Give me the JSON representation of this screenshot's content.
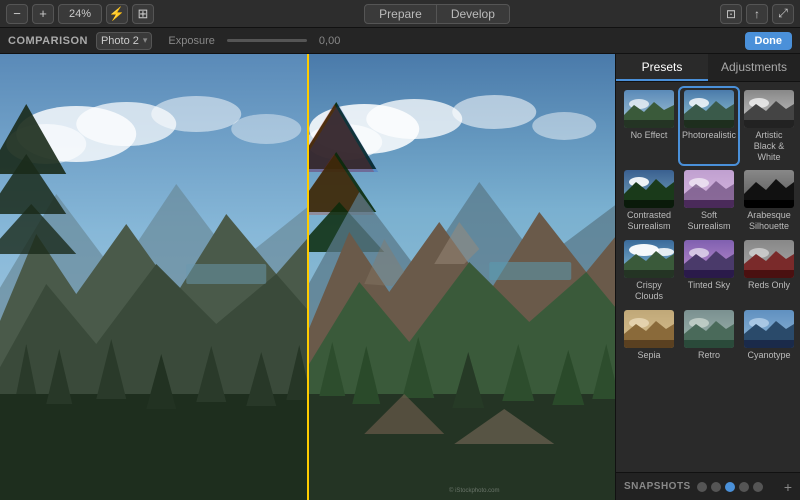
{
  "toolbar": {
    "zoom_out_icon": "−",
    "zoom_in_icon": "+",
    "zoom_level": "24%",
    "lightning_icon": "⚡",
    "layout_icon": "⊞",
    "prepare_label": "Prepare",
    "develop_label": "Develop",
    "window_icon": "⊡",
    "share_icon": "↑",
    "fullscreen_icon": "⤢"
  },
  "secondary_toolbar": {
    "comparison_label": "COMPARISON",
    "photo_label": "Photo 2",
    "exposure_label": "Exposure",
    "exposure_value": "0,00",
    "done_label": "Done"
  },
  "panel": {
    "presets_tab": "Presets",
    "adjustments_tab": "Adjustments",
    "presets": [
      {
        "id": "no-effect",
        "label": "No Effect",
        "style": "original",
        "selected": false
      },
      {
        "id": "photorealistic",
        "label": "Photorealistic",
        "style": "photorealistic",
        "selected": true
      },
      {
        "id": "artistic-bw",
        "label": "Artistic Black & White",
        "style": "bw",
        "selected": false
      },
      {
        "id": "contrasted-surrealism",
        "label": "Contrasted Surrealism",
        "style": "contrasted",
        "selected": false
      },
      {
        "id": "soft-surrealism",
        "label": "Soft Surrealism",
        "style": "soft",
        "selected": false
      },
      {
        "id": "arabesque-silhouette",
        "label": "Arabesque Silhouette",
        "style": "arabesque",
        "selected": false
      },
      {
        "id": "crispy-clouds",
        "label": "Crispy Clouds",
        "style": "crispy",
        "selected": false
      },
      {
        "id": "tinted-sky",
        "label": "Tinted Sky",
        "style": "tinted",
        "selected": false
      },
      {
        "id": "reds-only",
        "label": "Reds Only",
        "style": "reds",
        "selected": false
      },
      {
        "id": "sepia",
        "label": "Sepia",
        "style": "sepia",
        "selected": false
      },
      {
        "id": "retro",
        "label": "Retro",
        "style": "retro",
        "selected": false
      },
      {
        "id": "cyanotype",
        "label": "Cyanotype",
        "style": "cyanotype",
        "selected": false
      }
    ]
  },
  "snapshots": {
    "label": "SNAPSHOTS",
    "dots": [
      {
        "active": false
      },
      {
        "active": false
      },
      {
        "active": true
      },
      {
        "active": false
      },
      {
        "active": false
      }
    ],
    "add_icon": "+"
  }
}
